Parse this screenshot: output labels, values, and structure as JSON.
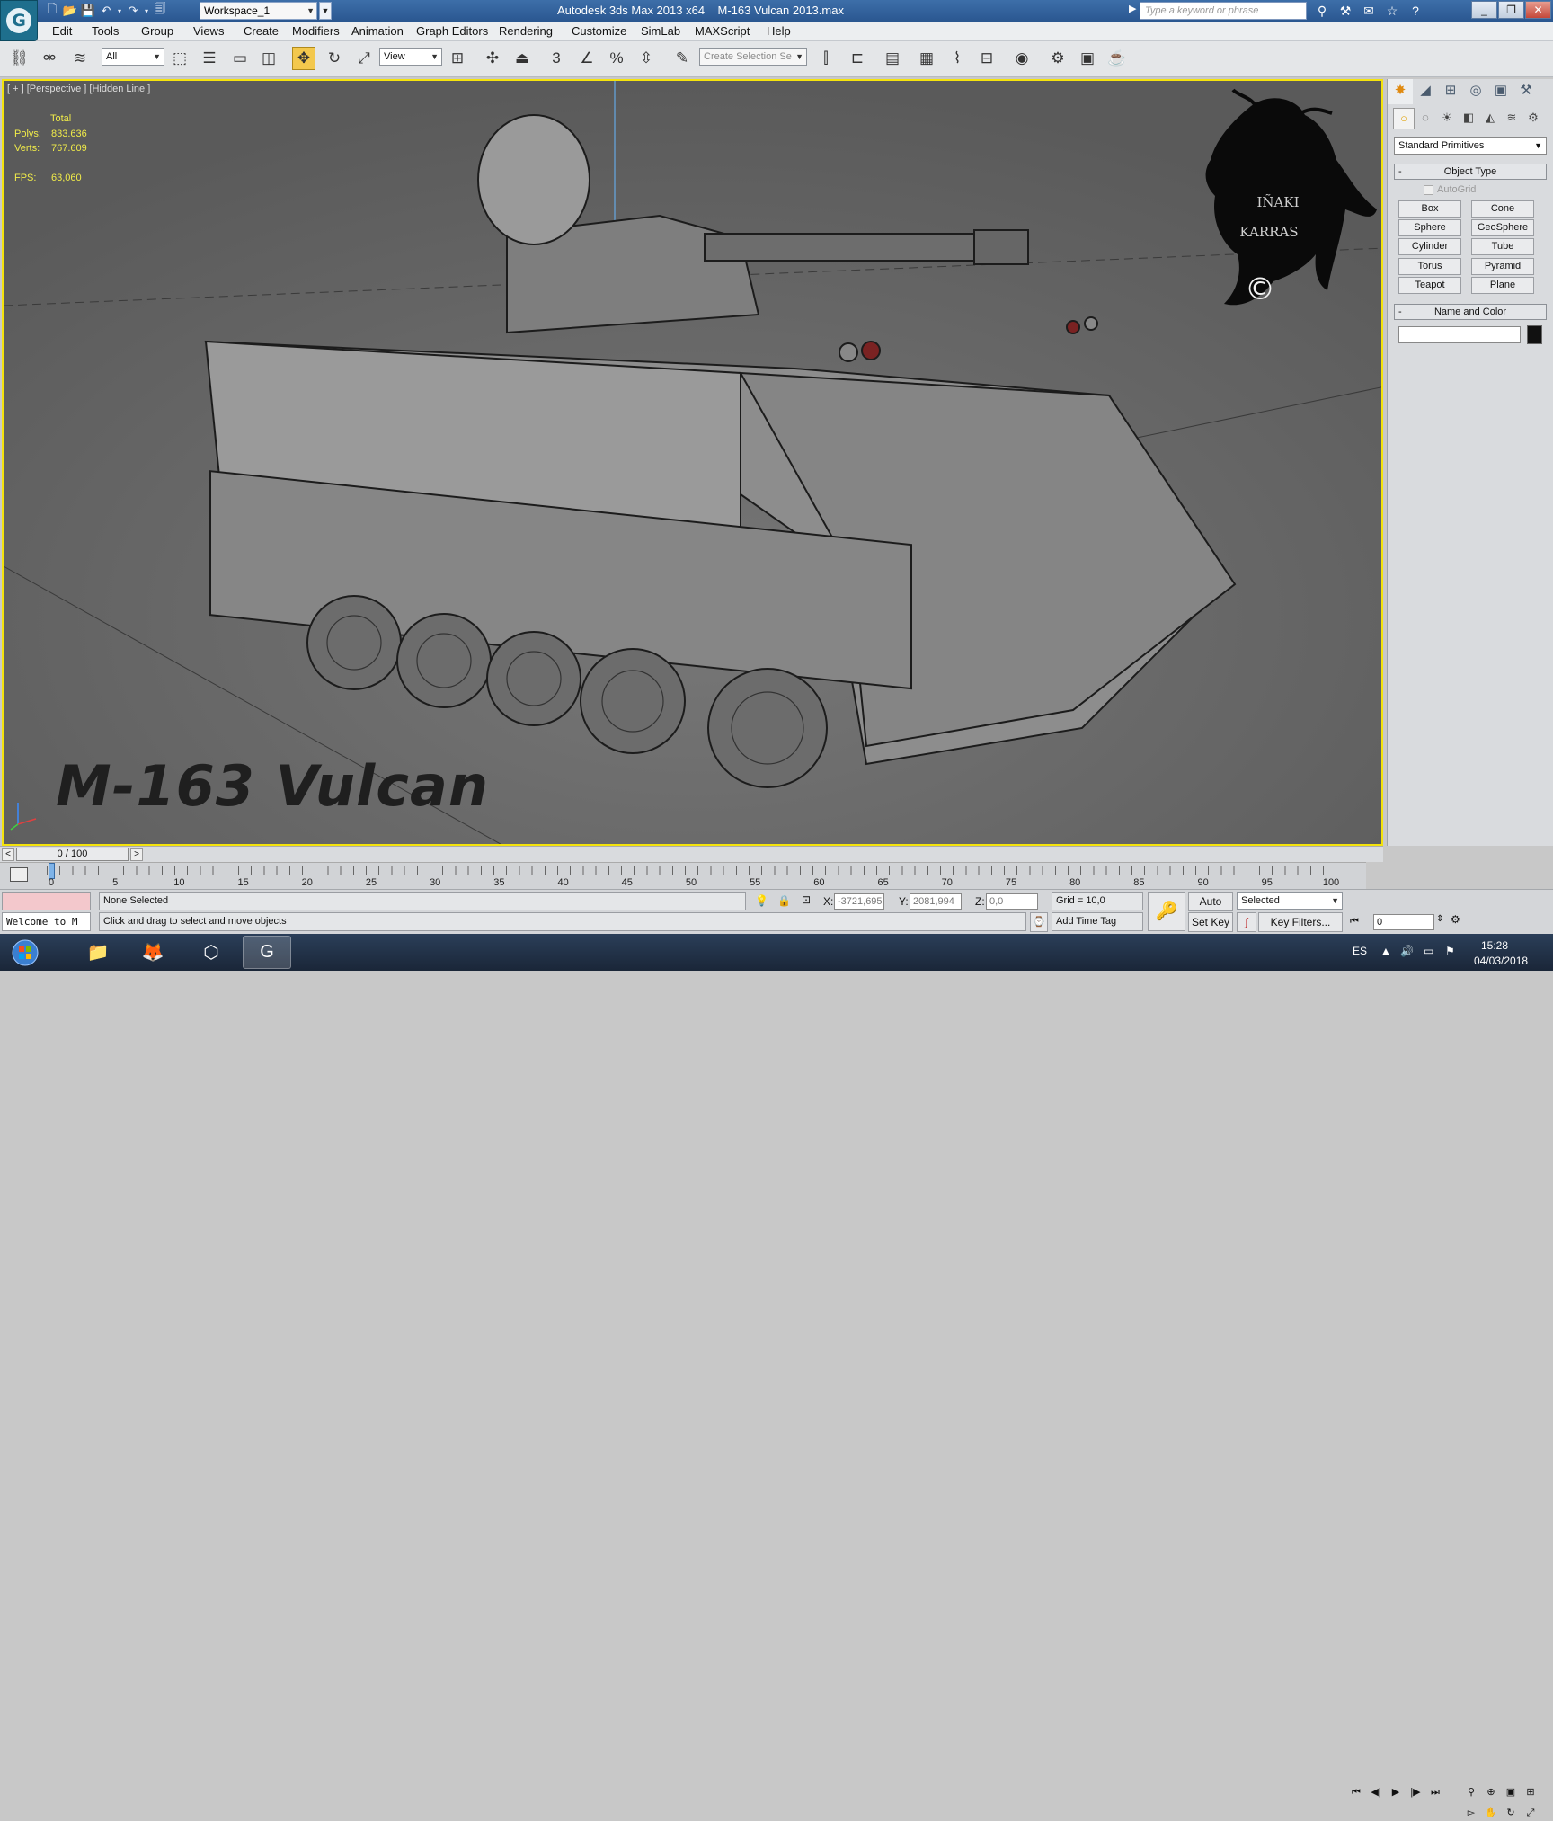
{
  "titlebar": {
    "app_title": "Autodesk 3ds Max  2013 x64",
    "file_name": "M-163  Vulcan 2013.max",
    "workspace": "Workspace_1",
    "search_placeholder": "Type a keyword or phrase"
  },
  "menu": [
    "Edit",
    "Tools",
    "Group",
    "Views",
    "Create",
    "Modifiers",
    "Animation",
    "Graph Editors",
    "Rendering",
    "Customize",
    "SimLab",
    "MAXScript",
    "Help"
  ],
  "toolbar": {
    "selection_filter": "All",
    "ref_coord": "View",
    "snap_label": "3",
    "named_selection_placeholder": "Create Selection Se"
  },
  "viewport": {
    "label": "[ + ] [Perspective ] [Hidden Line ]",
    "stats_header": "Total",
    "stats": [
      {
        "key": "Polys:",
        "value": "833.636"
      },
      {
        "key": "Verts:",
        "value": "767.609"
      }
    ],
    "fps_key": "FPS:",
    "fps_value": "63,060",
    "overlay_title": "M-163  Vulcan",
    "watermark_line1": "IÑAKI",
    "watermark_line2": "KARRAS",
    "watermark_copyright": "©",
    "stats_color": "#f1ec49",
    "border_color": "#f4e30c"
  },
  "timeline": {
    "slider": "0 / 100",
    "ticks": [
      "0",
      "5",
      "10",
      "15",
      "20",
      "25",
      "30",
      "35",
      "40",
      "45",
      "50",
      "55",
      "60",
      "65",
      "70",
      "75",
      "80",
      "85",
      "90",
      "95",
      "100"
    ]
  },
  "status": {
    "welcome": "Welcome to M",
    "selection": "None Selected",
    "prompt": "Click and drag to select and move objects",
    "x_label": "X:",
    "x_value": "-3721,695",
    "y_label": "Y:",
    "y_value": "2081,994",
    "z_label": "Z:",
    "z_value": "0,0",
    "grid": "Grid = 10,0",
    "add_time_tag": "Add Time Tag",
    "auto_key": "Auto Key",
    "set_key": "Set Key",
    "key_mode": "Selected",
    "key_filters": "Key Filters...",
    "frame": "0"
  },
  "command_panel": {
    "category": "Standard Primitives",
    "object_type": "Object Type",
    "autogrid": "AutoGrid",
    "primitives": [
      "Box",
      "Cone",
      "Sphere",
      "GeoSphere",
      "Cylinder",
      "Tube",
      "Torus",
      "Pyramid",
      "Teapot",
      "Plane"
    ],
    "name_and_color": "Name and Color",
    "object_color": "#111111"
  },
  "taskbar": {
    "lang": "ES",
    "time": "15:28",
    "date": "04/03/2018"
  }
}
